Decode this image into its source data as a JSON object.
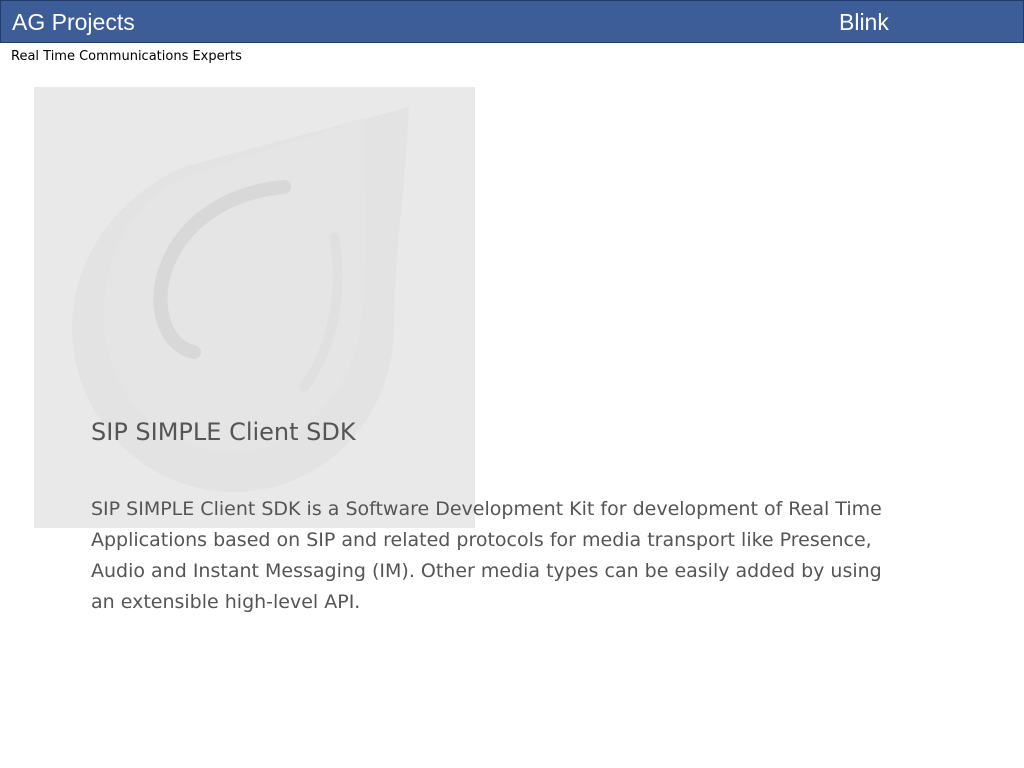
{
  "header": {
    "left_title": "AG Projects",
    "right_title": "Blink",
    "background": "#3d5d99"
  },
  "tagline": "Real Time Communications Experts",
  "watermark": {
    "icon": "blink-logo-icon"
  },
  "content": {
    "title": "SIP SIMPLE Client SDK",
    "body": "SIP SIMPLE Client SDK is a Software Development Kit for development of Real Time Applications based on SIP and related protocols for media transport like Presence, Audio and Instant Messaging (IM). Other media types can be easily added by using an extensible high-level API."
  }
}
